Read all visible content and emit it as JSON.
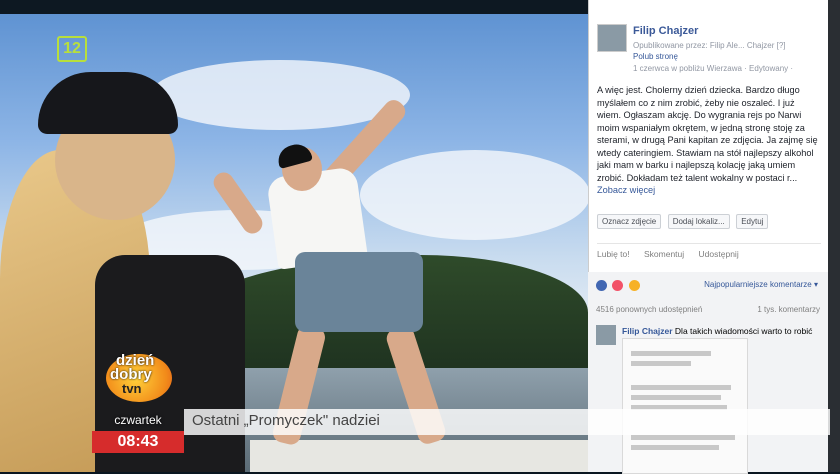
{
  "broadcast": {
    "channel_badge": "12",
    "show_logo": {
      "line1": "dzień",
      "line2": "dobry",
      "line3": "tvn"
    },
    "day": "czwartek",
    "time": "08:43",
    "ticker": "Ostatni „Promyczek\" nadziei",
    "colors": {
      "time_bg": "#d62c2c",
      "badge": "#b8df3c"
    }
  },
  "post": {
    "author": "Filip Chajzer",
    "published_by": "Opublikowane przez: Filip Ale... Chajzer [?]",
    "like_page": "Polub stronę",
    "meta": "1 czerwca w pobliżu Wierzawa · Edytowany ·",
    "text": "A więc jest. Cholerny dzień dziecka. Bardzo długo myślałem co z nim zrobić, żeby nie oszaleć. I już wiem. Ogłaszam akcję. Do wygrania rejs po Narwi moim wspaniałym okrętem, w jedną stronę stoję za sterami, w drugą Pani kapitan ze zdjęcia. Ja zajmę się wtedy cateringiem. Stawiam na stół najlepszy alkohol jaki mam w barku i najlepszą kolację jaką umiem zrobić. Dokładam też talent wokalny w postaci r...",
    "see_more": "Zobacz więcej",
    "actions": [
      "Oznacz zdjęcie",
      "Dodaj lokaliz...",
      "Edytuj"
    ],
    "like": "Lubię to!",
    "comment": "Skomentuj",
    "share": "Udostępnij",
    "top_comments": "Najpopularniejsze komentarze ▾",
    "shares_count": "4516 ponownych udostępnień",
    "comments_count": "1 tys. komentarzy",
    "comment_author": "Filip Chajzer",
    "comment_text": "Dla takich wiadomości warto to robić"
  }
}
